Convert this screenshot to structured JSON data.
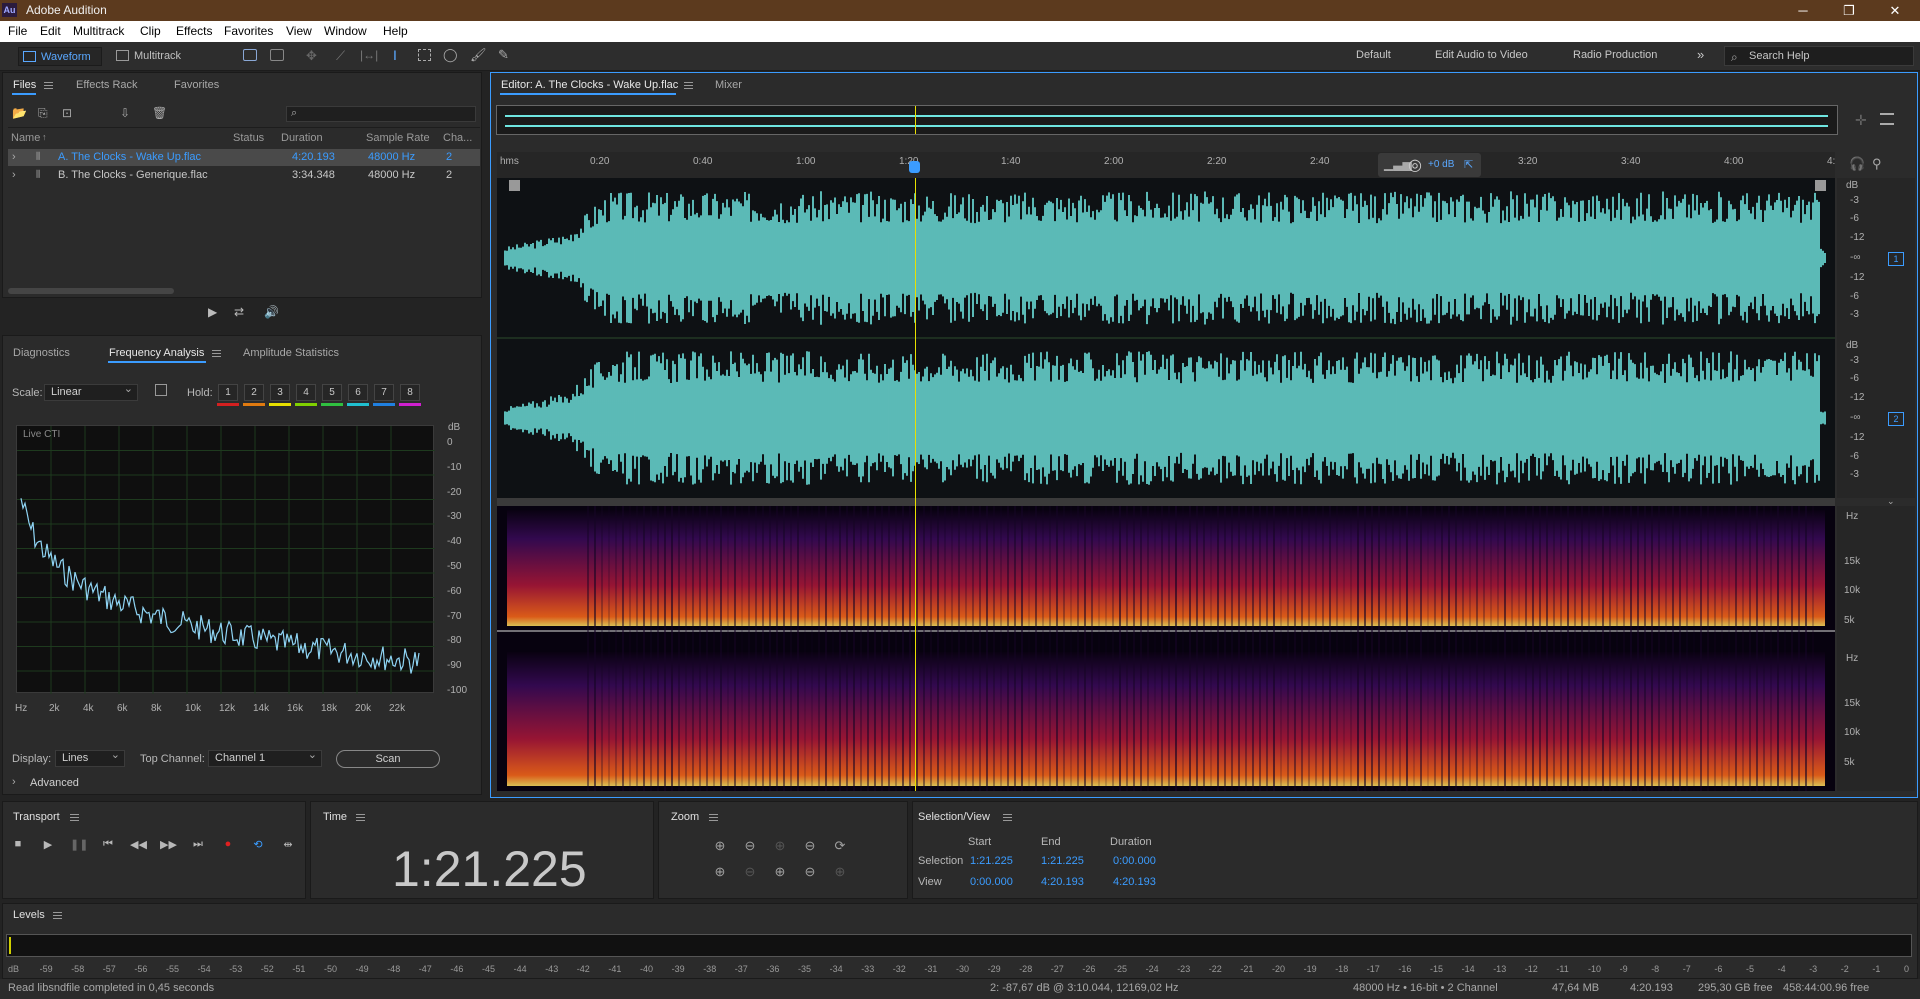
{
  "app": {
    "title": "Adobe Audition",
    "logo": "Au"
  },
  "menu": [
    "File",
    "Edit",
    "Multitrack",
    "Clip",
    "Effects",
    "Favorites",
    "View",
    "Window",
    "Help"
  ],
  "toolbar": {
    "waveform": "Waveform",
    "multitrack": "Multitrack",
    "workspaces": [
      "Default",
      "Edit Audio to Video",
      "Radio Production"
    ],
    "search_placeholder": "Search Help"
  },
  "files_panel": {
    "tabs": [
      "Files",
      "Effects Rack",
      "Favorites"
    ],
    "columns": [
      "Name",
      "Status",
      "Duration",
      "Sample Rate",
      "Cha..."
    ],
    "rows": [
      {
        "name": "A. The Clocks - Wake Up.flac",
        "status": "",
        "duration": "4:20.193",
        "rate": "48000 Hz",
        "ch": "2",
        "selected": true
      },
      {
        "name": "B. The Clocks - Generique.flac",
        "status": "",
        "duration": "3:34.348",
        "rate": "48000 Hz",
        "ch": "2",
        "selected": false
      }
    ]
  },
  "analysis": {
    "tabs": [
      "Diagnostics",
      "Frequency Analysis",
      "Amplitude Statistics"
    ],
    "scale_label": "Scale:",
    "scale": "Linear",
    "hold_label": "Hold:",
    "hold": [
      "1",
      "2",
      "3",
      "4",
      "5",
      "6",
      "7",
      "8"
    ],
    "hold_colors": [
      "#d42020",
      "#e07a10",
      "#e8e000",
      "#80d000",
      "#30c040",
      "#20c0d0",
      "#2080e0",
      "#d020d0"
    ],
    "live": "Live CTI",
    "db_unit": "dB",
    "y_ticks": [
      "0",
      "-10",
      "-20",
      "-30",
      "-40",
      "-50",
      "-60",
      "-70",
      "-80",
      "-90",
      "-100"
    ],
    "x_ticks": [
      "Hz",
      "2k",
      "4k",
      "6k",
      "8k",
      "10k",
      "12k",
      "14k",
      "16k",
      "18k",
      "20k",
      "22k"
    ],
    "display_label": "Display:",
    "display": "Lines",
    "top_channel_label": "Top Channel:",
    "top_channel": "Channel 1",
    "scan": "Scan",
    "advanced": "Advanced"
  },
  "editor": {
    "tab": "Editor: A. The Clocks - Wake Up.flac",
    "mixer": "Mixer",
    "time_ticks": [
      "hms",
      "0:20",
      "0:40",
      "1:00",
      "1:20",
      "1:40",
      "2:00",
      "2:20",
      "2:40",
      "3:20",
      "3:40",
      "4:00",
      "4:"
    ],
    "gain": "+0 dB",
    "db_unit": "dB",
    "db_ticks": [
      "-3",
      "-6",
      "-12",
      "-∞",
      "-12",
      "-6",
      "-3"
    ],
    "ch1": "1",
    "ch2": "2",
    "hz_unit": "Hz",
    "hz_ticks": [
      "15k",
      "10k",
      "5k"
    ]
  },
  "transport": {
    "title": "Transport"
  },
  "time": {
    "title": "Time",
    "value": "1:21.225"
  },
  "zoom": {
    "title": "Zoom"
  },
  "selection": {
    "title": "Selection/View",
    "headers": [
      "Start",
      "End",
      "Duration"
    ],
    "selection_label": "Selection",
    "view_label": "View",
    "selection": [
      "1:21.225",
      "1:21.225",
      "0:00.000"
    ],
    "view": [
      "0:00.000",
      "4:20.193",
      "4:20.193"
    ]
  },
  "levels": {
    "title": "Levels",
    "ticks": [
      "dB",
      "-59",
      "-58",
      "-57",
      "-56",
      "-55",
      "-54",
      "-53",
      "-52",
      "-51",
      "-50",
      "-49",
      "-48",
      "-47",
      "-46",
      "-45",
      "-44",
      "-43",
      "-42",
      "-41",
      "-40",
      "-39",
      "-38",
      "-37",
      "-36",
      "-35",
      "-34",
      "-33",
      "-32",
      "-31",
      "-30",
      "-29",
      "-28",
      "-27",
      "-26",
      "-25",
      "-24",
      "-23",
      "-22",
      "-21",
      "-20",
      "-19",
      "-18",
      "-17",
      "-16",
      "-15",
      "-14",
      "-13",
      "-12",
      "-11",
      "-10",
      "-9",
      "-8",
      "-7",
      "-6",
      "-5",
      "-4",
      "-3",
      "-2",
      "-1",
      "0"
    ]
  },
  "status": {
    "left": "Read libsndfile completed in 0,45 seconds",
    "cursor": "2: -87,67 dB @ 3:10.044, 12169,02 Hz",
    "format": "48000 Hz • 16-bit • 2 Channel",
    "size": "47,64 MB",
    "duration": "4:20.193",
    "free": "295,30 GB free",
    "free_time": "458:44:00.96 free"
  },
  "colors": {
    "accent": "#3b9cff",
    "waveform": "#6fe5e0",
    "playhead": "#e8e000",
    "title_bar": "#5c3a1e"
  }
}
